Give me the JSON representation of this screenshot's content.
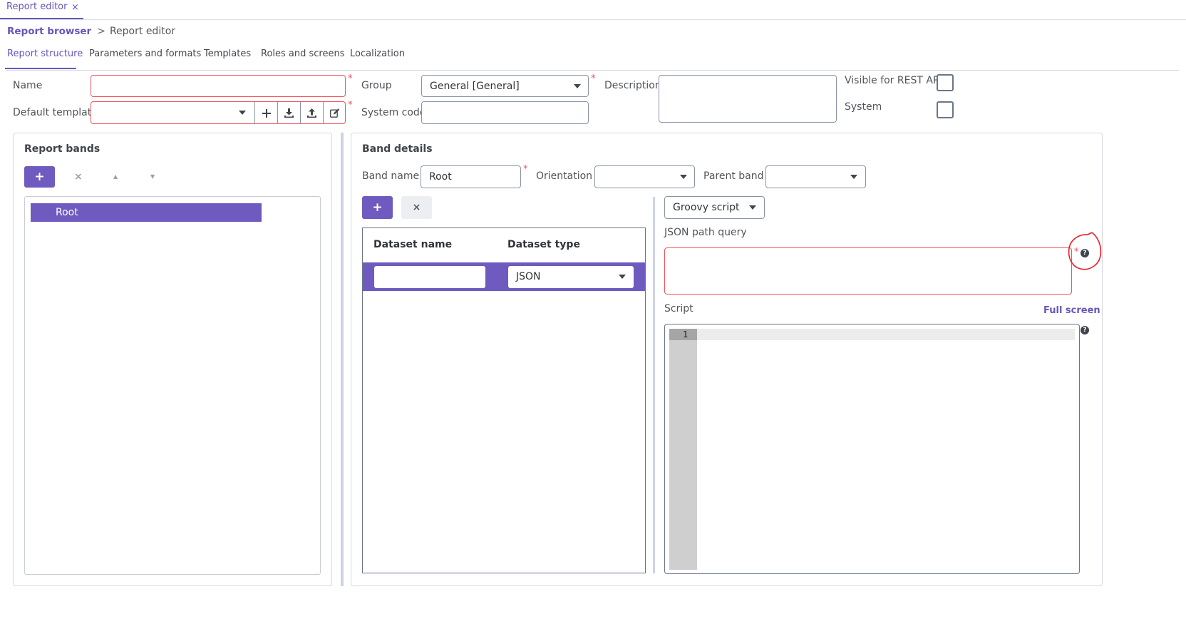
{
  "app_tab": {
    "title": "Report editor",
    "close": "×"
  },
  "breadcrumb": {
    "link": "Report browser",
    "separator": ">",
    "current": "Report editor"
  },
  "tabs": [
    {
      "label": "Report structure",
      "active": true
    },
    {
      "label": "Parameters and formats"
    },
    {
      "label": "Templates"
    },
    {
      "label": "Roles and screens"
    },
    {
      "label": "Localization"
    }
  ],
  "form": {
    "name_label": "Name",
    "name_value": "",
    "default_template_label": "Default template",
    "default_template_value": "",
    "group_label": "Group",
    "group_value": "General [General]",
    "system_code_label": "System code",
    "system_code_value": "",
    "description_label": "Description",
    "description_value": "",
    "visible_rest_label": "Visible for REST API",
    "system_label": "System",
    "required_mark": "*"
  },
  "report_bands": {
    "title": "Report bands",
    "add": "+",
    "remove": "×",
    "up": "▲",
    "down": "▼",
    "items": [
      "Root"
    ]
  },
  "band_details": {
    "title": "Band details",
    "band_name_label": "Band name",
    "band_name_value": "Root",
    "orientation_label": "Orientation",
    "orientation_value": "",
    "parent_band_label": "Parent band",
    "parent_band_value": "",
    "add": "+",
    "remove": "×",
    "table_headers": [
      "Dataset name",
      "Dataset type"
    ],
    "row": {
      "name": "",
      "type": "JSON"
    },
    "script_type": "Groovy script",
    "json_path_label": "JSON path query",
    "json_path_value": "",
    "script_label": "Script",
    "full_screen": "Full screen",
    "line_number": "1",
    "help": "?"
  },
  "colors": {
    "accent": "#6a55b9",
    "required": "#f0535e",
    "annotation": "#e8202a"
  }
}
